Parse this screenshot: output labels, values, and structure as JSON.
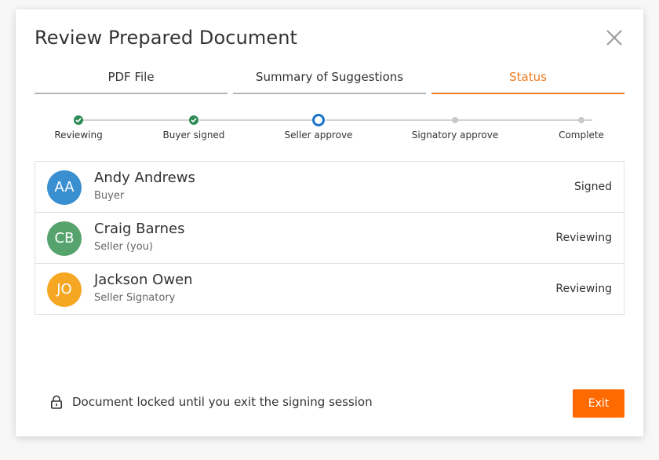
{
  "dialog": {
    "title": "Review Prepared Document",
    "close_icon": "close-icon"
  },
  "tabs": [
    {
      "label": "PDF File",
      "active": false
    },
    {
      "label": "Summary of Suggestions",
      "active": false
    },
    {
      "label": "Status",
      "active": true
    }
  ],
  "progress": {
    "steps": [
      {
        "label": "Reviewing",
        "state": "done"
      },
      {
        "label": "Buyer signed",
        "state": "done"
      },
      {
        "label": "Seller approve",
        "state": "current"
      },
      {
        "label": "Signatory approve",
        "state": "pending"
      },
      {
        "label": "Complete",
        "state": "pending"
      }
    ]
  },
  "people": [
    {
      "initials": "AA",
      "name": "Andy Andrews",
      "role": "Buyer",
      "status": "Signed",
      "color": "#3a8fd0"
    },
    {
      "initials": "CB",
      "name": "Craig Barnes",
      "role": "Seller (you)",
      "status": "Reviewing",
      "color": "#56a36d"
    },
    {
      "initials": "JO",
      "name": "Jackson Owen",
      "role": "Seller Signatory",
      "status": "Reviewing",
      "color": "#f5a623"
    }
  ],
  "footer": {
    "lock_icon": "lock-icon",
    "note": "Document locked until you exit the signing session",
    "exit_label": "Exit"
  },
  "colors": {
    "accent": "#ee7c20",
    "exit_button": "#ff6a00",
    "step_done": "#2e8b57",
    "step_current": "#1a73c9",
    "step_pending": "#c8c8c8"
  }
}
